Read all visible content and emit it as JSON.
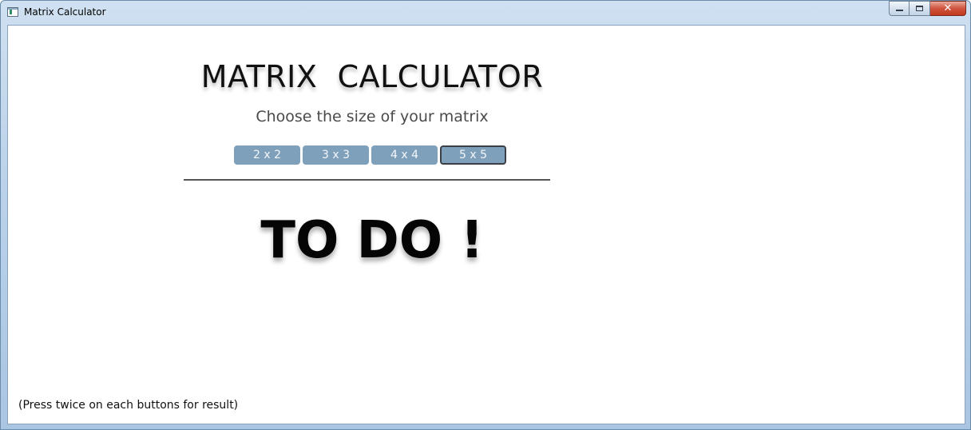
{
  "window": {
    "title": "Matrix Calculator",
    "controls": {
      "minimize": "minimize-icon",
      "maximize": "maximize-icon",
      "close": "✕"
    }
  },
  "app": {
    "title": "MATRIX  CALCULATOR",
    "subtitle": "Choose the size of your matrix",
    "size_buttons": [
      {
        "label": "2 x 2",
        "selected": false
      },
      {
        "label": "3 x 3",
        "selected": false
      },
      {
        "label": "4 x 4",
        "selected": false
      },
      {
        "label": "5 x 5",
        "selected": true
      }
    ],
    "result_text": "TO DO !",
    "hint": "(Press twice on each buttons for result)"
  },
  "colors": {
    "button_bg": "#7fa0bb",
    "button_text": "#f4f7fa",
    "selected_border": "#3a3f45"
  }
}
